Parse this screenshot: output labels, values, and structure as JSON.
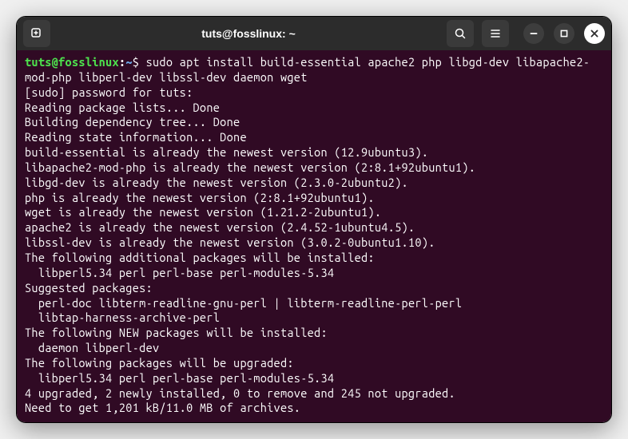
{
  "titlebar": {
    "title": "tuts@fosslinux: ~"
  },
  "prompt": {
    "user_host": "tuts@fosslinux",
    "colon": ":",
    "path": "~",
    "dollar": "$ "
  },
  "command": "sudo apt install build-essential apache2 php libgd-dev libapache2-mod-php libperl-dev libssl-dev daemon wget",
  "output_lines": [
    "[sudo] password for tuts:",
    "Reading package lists... Done",
    "Building dependency tree... Done",
    "Reading state information... Done",
    "build-essential is already the newest version (12.9ubuntu3).",
    "libapache2-mod-php is already the newest version (2:8.1+92ubuntu1).",
    "libgd-dev is already the newest version (2.3.0-2ubuntu2).",
    "php is already the newest version (2:8.1+92ubuntu1).",
    "wget is already the newest version (1.21.2-2ubuntu1).",
    "apache2 is already the newest version (2.4.52-1ubuntu4.5).",
    "libssl-dev is already the newest version (3.0.2-0ubuntu1.10).",
    "The following additional packages will be installed:",
    "  libperl5.34 perl perl-base perl-modules-5.34",
    "Suggested packages:",
    "  perl-doc libterm-readline-gnu-perl | libterm-readline-perl-perl",
    "  libtap-harness-archive-perl",
    "The following NEW packages will be installed:",
    "  daemon libperl-dev",
    "The following packages will be upgraded:",
    "  libperl5.34 perl perl-base perl-modules-5.34",
    "4 upgraded, 2 newly installed, 0 to remove and 245 not upgraded.",
    "Need to get 1,201 kB/11.0 MB of archives."
  ]
}
